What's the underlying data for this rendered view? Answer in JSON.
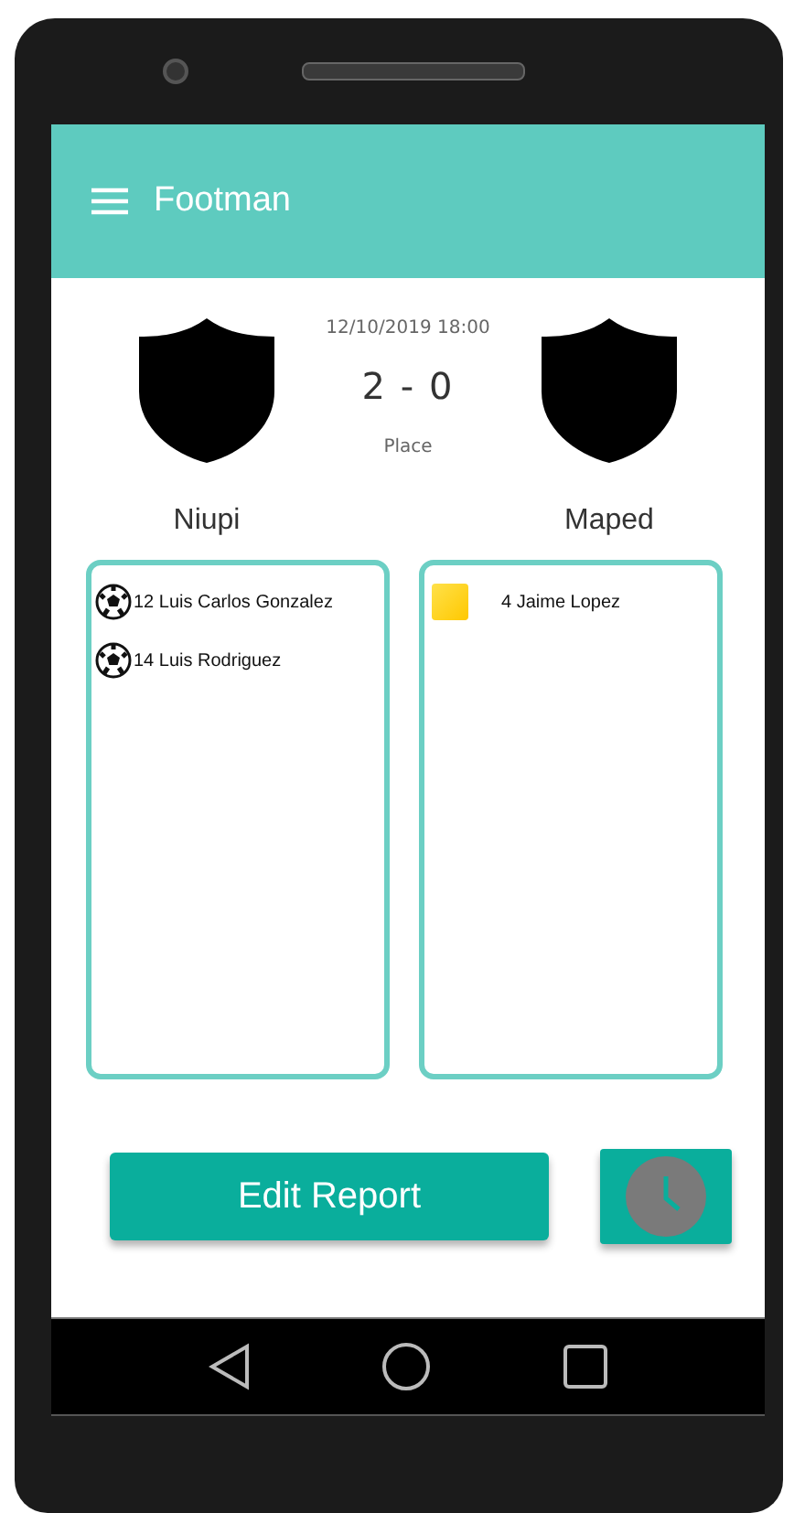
{
  "app_bar": {
    "title": "Footman"
  },
  "match": {
    "datetime": "12/10/2019 18:00",
    "score": "2 - 0",
    "place": "Place"
  },
  "teams": [
    {
      "name": "Niupi",
      "events": [
        {
          "kind": "goal",
          "text": "12 Luis Carlos Gonzalez"
        },
        {
          "kind": "goal",
          "text": "14 Luis Rodriguez"
        }
      ]
    },
    {
      "name": "Maped",
      "events": [
        {
          "kind": "yellow_card",
          "text": "4 Jaime Lopez"
        }
      ]
    }
  ],
  "actions": {
    "primary": "Edit Report"
  }
}
